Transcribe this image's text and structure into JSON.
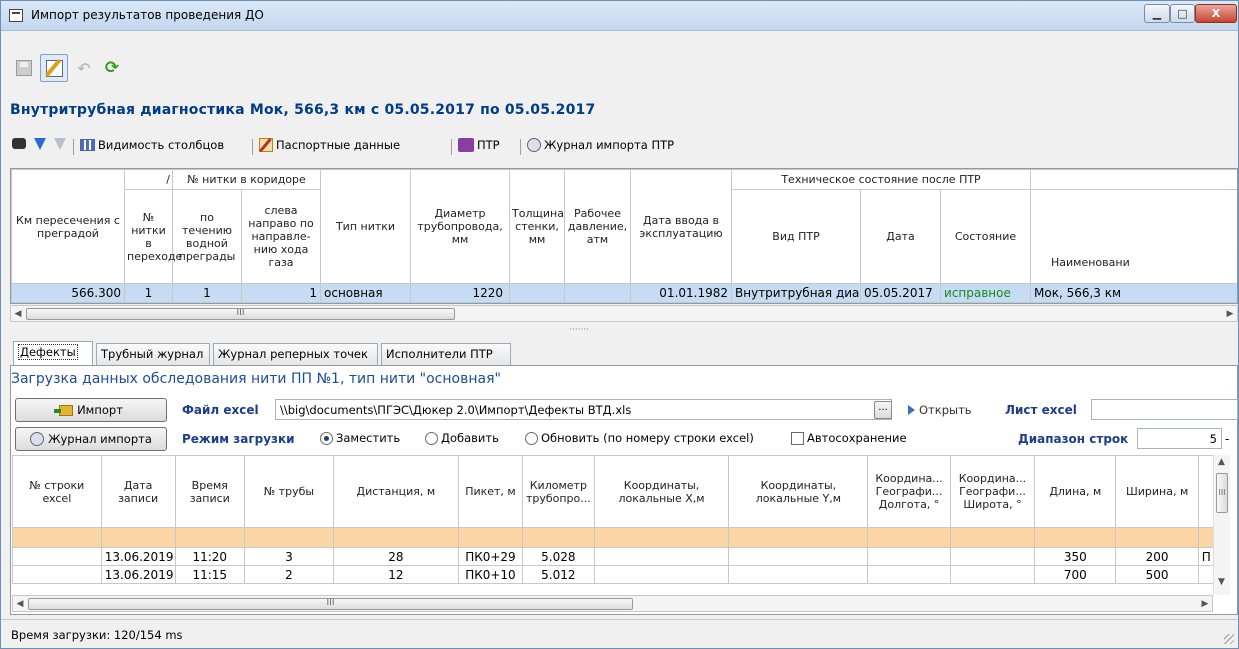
{
  "window": {
    "title": "Импорт результатов проведения ДО",
    "min_label": "▁",
    "max_label": "□",
    "close_label": "X"
  },
  "heading": "Внутритрубная диагностика Мок, 566,3 км с 05.05.2017 по 05.05.2017",
  "toolbar2": {
    "columns_visibility": "Видимость столбцов",
    "passport_data": "Паспортные данные",
    "ptr": "ПТР",
    "ptr_import_journal": "Журнал импорта ПТР"
  },
  "grid1": {
    "headers": {
      "km": "Км пересечения с преградой",
      "slash": "/",
      "line_in_corridor": "№ нитки в коридоре",
      "line_in_crossing": "№ нитки в переходе",
      "along_flow": "по течению водной преграды",
      "left_to_right": "слева направо по направле-нию хода газа",
      "line_type": "Тип нитки",
      "diameter": "Диаметр трубопровода, мм",
      "wall": "Толщина стенки, мм",
      "pressure": "Рабочее давление, атм",
      "commission_date": "Дата ввода в эксплуатацию",
      "tech_state": "Техническое состояние после ПТР",
      "ptr_type": "Вид ПТР",
      "date": "Дата",
      "state": "Состояние",
      "name": "Наименовани"
    },
    "row": {
      "km": "566.300",
      "in_crossing": "1",
      "along_flow": "1",
      "left_to_right": "1",
      "line_type": "основная",
      "diameter": "1220",
      "wall": "",
      "pressure": "",
      "commission_date": "01.01.1982",
      "ptr_type": "Внутритрубная диагн",
      "date": "05.05.2017",
      "state": "исправное",
      "name": "Мок, 566,3 км"
    }
  },
  "tabs": [
    "Дефекты",
    "Трубный журнал",
    "Журнал реперных точек",
    "Исполнители ПТР"
  ],
  "panel": {
    "sub_heading": "Загрузка данных обследования нити ПП №1, тип нити \"основная\"",
    "import_button": "Импорт",
    "import_journal_button": "Журнал импорта",
    "excel_file_label": "Файл excel",
    "excel_file_value": "\\\\big\\documents\\ПГЭС\\Дюкер 2.0\\Импорт\\Дефекты ВТД.xls",
    "browse_label": "...",
    "open_label": "Открыть",
    "sheet_label": "Лист excel",
    "sheet_value": "",
    "load_mode_label": "Режим загрузки",
    "mode_replace": "Заместить",
    "mode_add": "Добавить",
    "mode_update": "Обновить (по номеру строки excel)",
    "autosave": "Автосохранение",
    "row_range_label": "Диапазон строк",
    "row_range_from": "5",
    "row_range_dash": "-"
  },
  "grid2": {
    "headers": [
      "№ строки excel",
      "Дата записи",
      "Время записи",
      "№ трубы",
      "Дистанция, м",
      "Пикет, м",
      "Километр трубопро...",
      "Координаты, локальные X,м",
      "Координаты, локальные Y,м",
      "Координа... Географи... Долгота, °",
      "Координа... Географи... Широта, °",
      "Длина, м",
      "Ширина, м",
      ""
    ],
    "rows": [
      [
        "",
        "13.06.2019",
        "11:20",
        "3",
        "28",
        "ПК0+29",
        "5.028",
        "",
        "",
        "",
        "",
        "350",
        "200",
        "П"
      ],
      [
        "",
        "13.06.2019",
        "11:15",
        "2",
        "12",
        "ПК0+10",
        "5.012",
        "",
        "",
        "",
        "",
        "700",
        "500",
        ""
      ]
    ]
  },
  "scroll_glyphs": {
    "left": "◀",
    "right": "▶",
    "up": "▲",
    "down": "▼",
    "thumb_grip": "III",
    "splitter": "·······"
  },
  "status": "Время загрузки: 120/154 ms",
  "colors": {
    "heading": "#003c88",
    "selected_row": "#c6dcf4",
    "new_row": "#fbd5a3",
    "ok_state": "#1a8a1a"
  }
}
